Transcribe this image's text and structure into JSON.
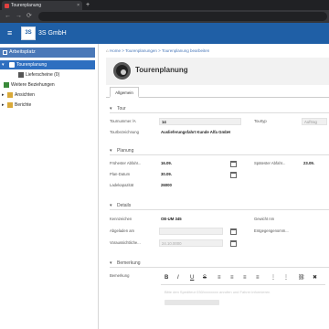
{
  "browser": {
    "tab_title": "Tourenplanung",
    "tab_close": "×",
    "new_tab": "+",
    "back": "←",
    "forward": "→",
    "reload": "⟳"
  },
  "app": {
    "menu_icon": "≡",
    "logo_text": "3S",
    "name": "3S GmbH",
    "brand_color": "#1f5fa6"
  },
  "sidebar": {
    "header": "Arbeitsplatz",
    "items": [
      {
        "label": "Tourenplanung",
        "active": true,
        "icon": "truck-icon"
      },
      {
        "label": "Lieferscheine (0)",
        "icon": "document-icon"
      },
      {
        "label": "Weitere Beziehungen",
        "icon": "link-icon"
      },
      {
        "label": "Ansichten",
        "icon": "folder-icon"
      },
      {
        "label": "Berichte",
        "icon": "folder-icon"
      }
    ]
  },
  "breadcrumb": {
    "home": "Home",
    "level1": "Tourenplanungen",
    "current": "Tourenplanung bearbeiten",
    "separator": ">"
  },
  "page": {
    "title": "Tourenplanung",
    "tab": "Allgemein"
  },
  "sections": {
    "tour": {
      "title": "Tour",
      "tournummer_label": "Tournummer /A",
      "tournummer_value": "14",
      "tourbezeichnung_label": "Tourbezeichnung",
      "tourbezeichnung_value": "Auslieferungsfahrt Kunde Alfa GmbH",
      "tourtyp_label": "Tourtyp",
      "tourtyp_value": "Auftrag"
    },
    "planung": {
      "title": "Planung",
      "fruehester_label": "Frühester Abfahr...",
      "fruehester_value": "16.09.",
      "spaetester_label": "Spätester Abfahr...",
      "spaetester_value": "23.09.",
      "plan_datum_label": "Plan-Datum",
      "plan_datum_value": "30.09.",
      "ladekapazitaet_label": "Ladekapazität",
      "ladekapazitaet_value": "26000"
    },
    "details": {
      "title": "Details",
      "kennzeichen_label": "Kennzeichen",
      "kennzeichen_value": "OE-UM 345",
      "gewicht_label": "Gewicht nm",
      "abgeladen_label": "Abgeladen am",
      "entgegengenommen_label": "Entgegengenomm...",
      "voraussichtlich_label": "Voraussichtliche...",
      "voraussichtlich_value": "24.10.0000"
    },
    "bemerkung": {
      "title": "Bemerkung",
      "label": "Bemerkung",
      "toolbar": [
        "B",
        "I",
        "U",
        "S",
        "≡",
        "≡",
        "≡",
        "≡",
        "⋮",
        "⋮",
        "⛓",
        "✖"
      ],
      "text": "Bitte den Spediteur 030/xxxxxxxx anrufen und Fahrer informieren"
    }
  }
}
